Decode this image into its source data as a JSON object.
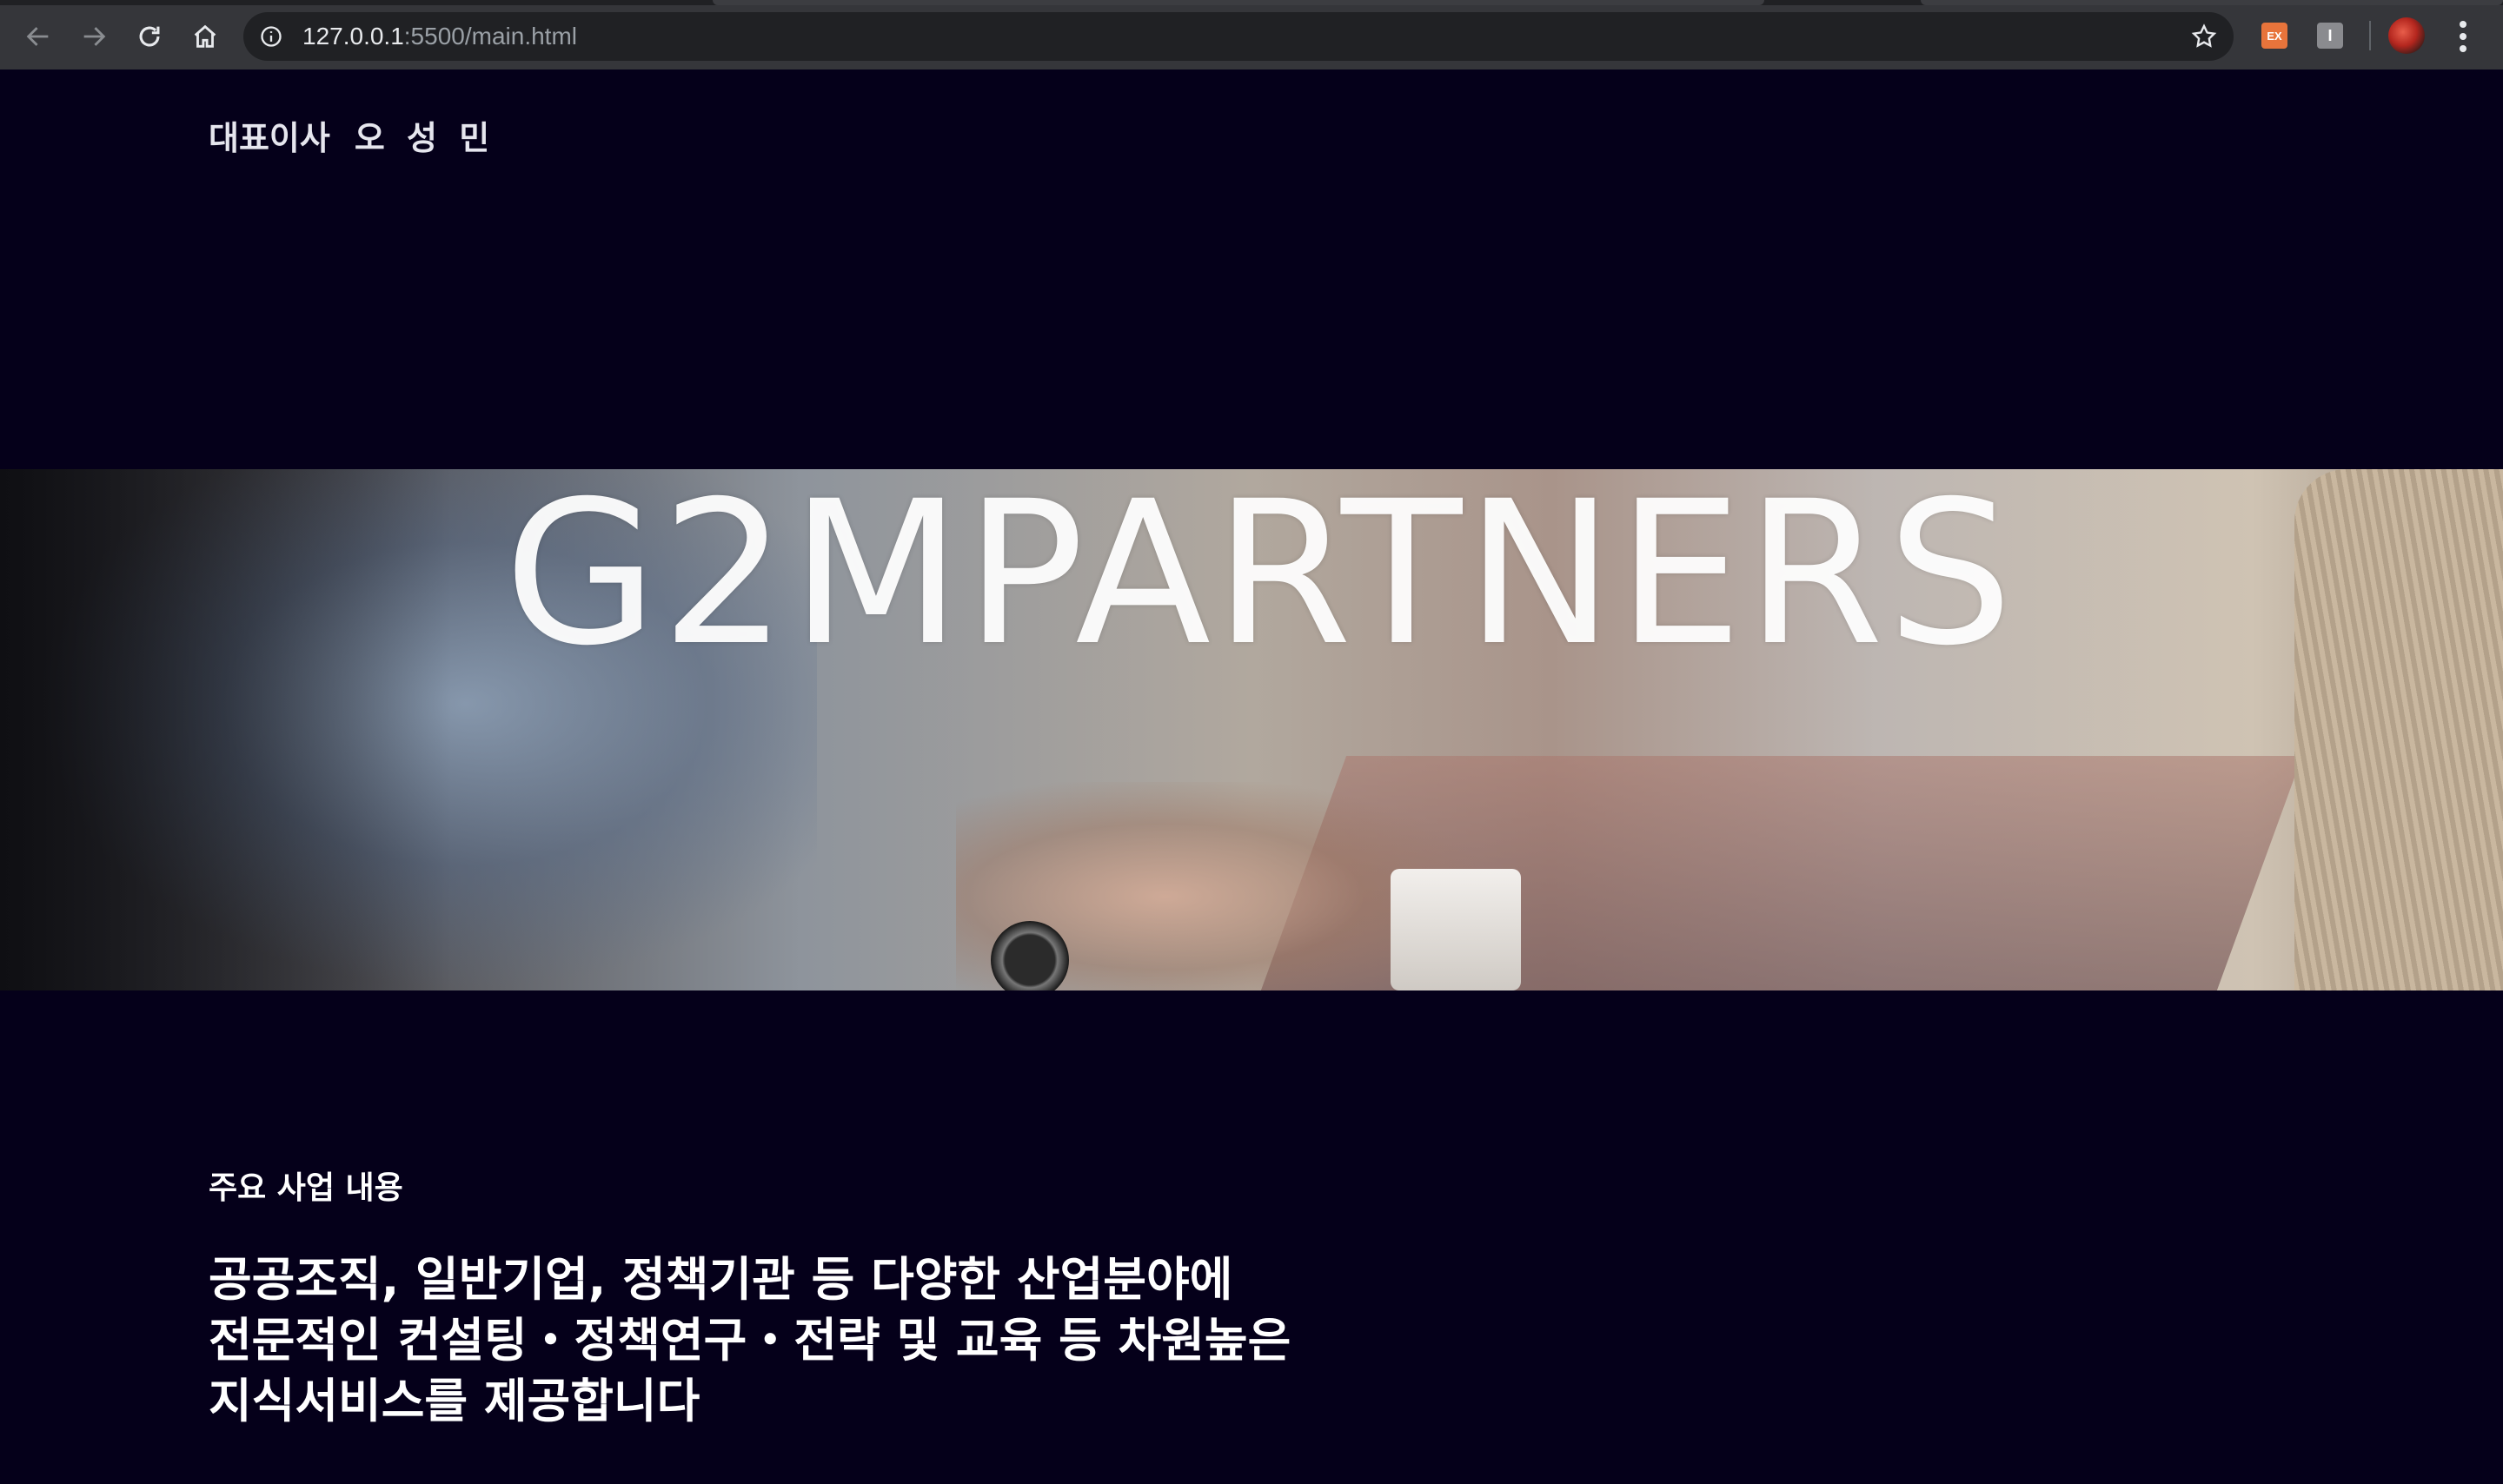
{
  "browser": {
    "url_host": "127.0.0.1",
    "url_path": ":5500/main.html",
    "extension_1": "EX",
    "extension_2": "I"
  },
  "page": {
    "ceo_title": "대표이사",
    "ceo_name": "오 성 민",
    "hero_title": "G2MPARTNERS",
    "section_label": "주요 사업 내용",
    "headline_lines": [
      "공공조직, 일반기업, 정책기관 등 다양한 산업분야에",
      "전문적인 컨설팅・정책연구・전략 및 교육 등 차원높은",
      "지식서비스를 제공합니다"
    ]
  },
  "colors": {
    "page_background": "#05001a",
    "chrome_background": "#35363a",
    "omnibox_background": "#202124"
  }
}
